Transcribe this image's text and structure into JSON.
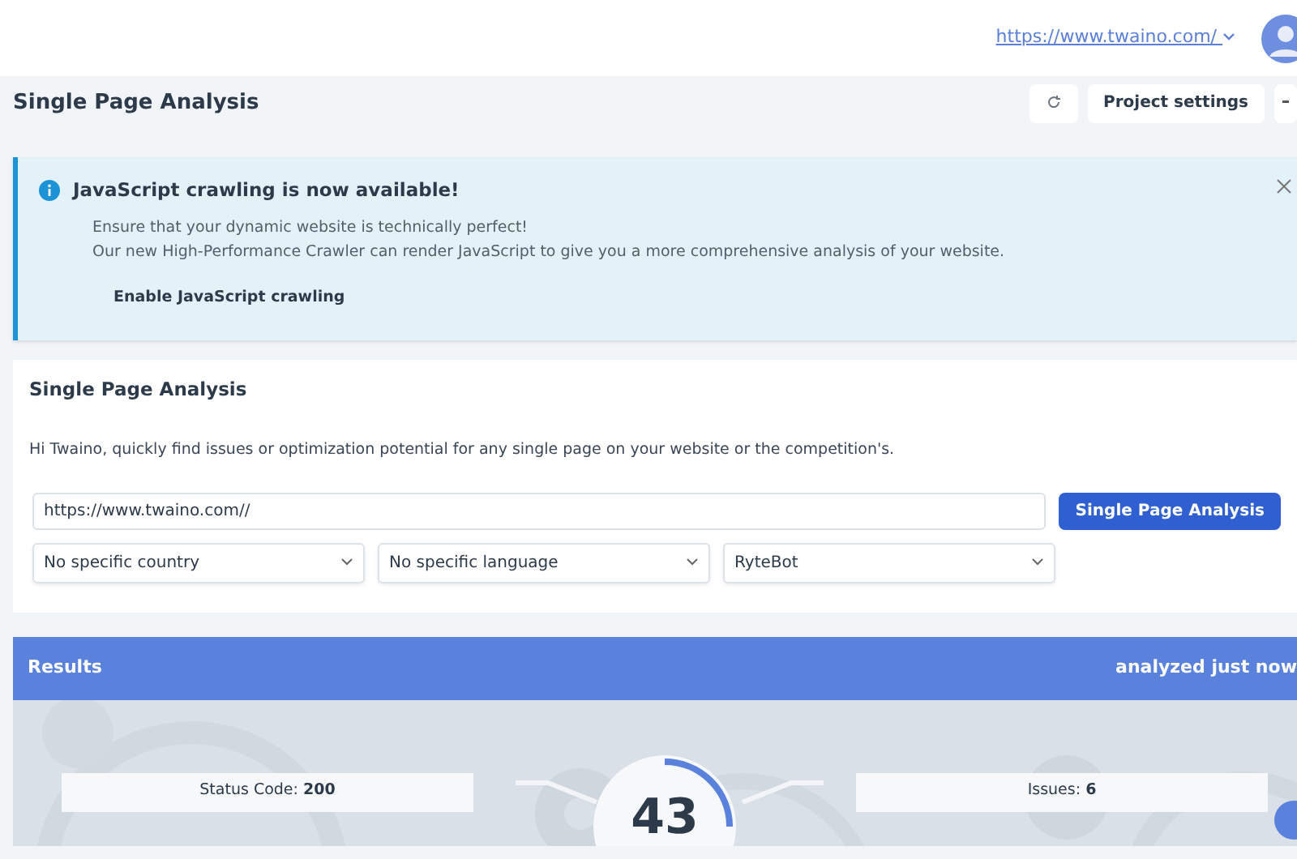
{
  "topbar": {
    "project_url": "https://www.twaino.com/"
  },
  "header": {
    "title": "Single Page Analysis",
    "settings_button": "Project settings"
  },
  "alert": {
    "title": "JavaScript crawling is now available!",
    "lines": [
      "Ensure that your dynamic website is technically perfect!",
      "Our new High-Performance Crawler can render JavaScript to give you a more comprehensive analysis of your website."
    ],
    "action": "Enable JavaScript crawling"
  },
  "analysis": {
    "title": "Single Page Analysis",
    "intro": "Hi Twaino, quickly find issues or optimization potential for any single page on your website or the competition's.",
    "url_value": "https://www.twaino.com//",
    "button": "Single Page Analysis",
    "selects": [
      "No specific country",
      "No specific language",
      "RyteBot"
    ]
  },
  "results": {
    "title": "Results",
    "analyzed": "analyzed just now",
    "left": {
      "label": "Status Code:",
      "value": "200"
    },
    "right": {
      "label": "Issues:",
      "value": "6"
    },
    "score": {
      "value": "43"
    }
  }
}
